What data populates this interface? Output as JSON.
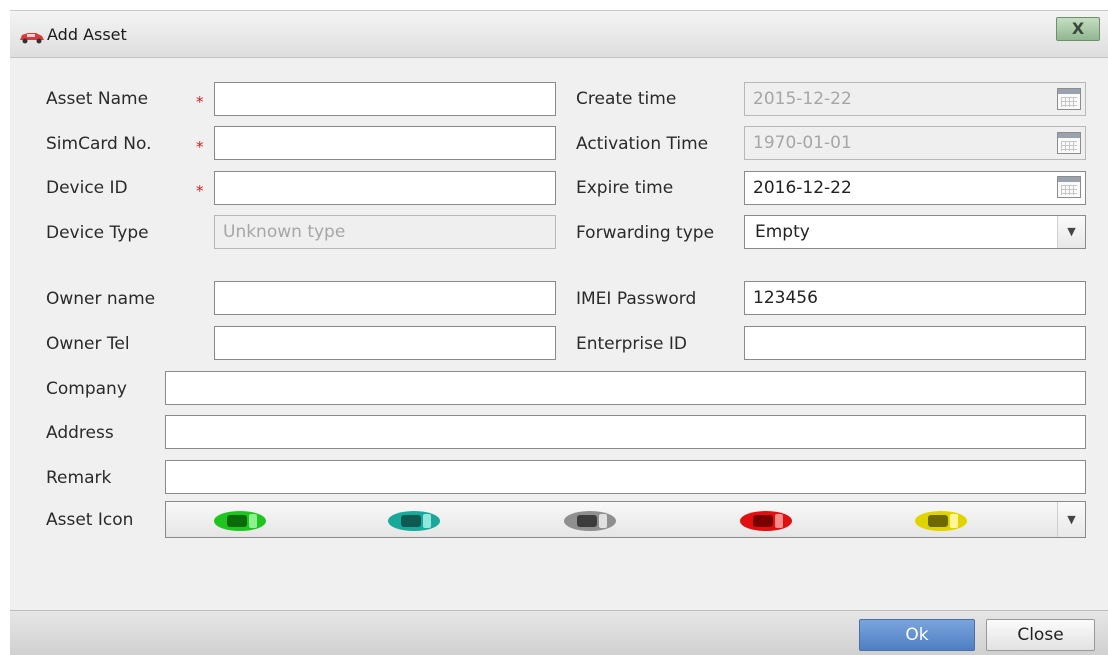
{
  "dialog": {
    "title": "Add Asset",
    "close_symbol": "X"
  },
  "form": {
    "asset_name": {
      "label": "Asset Name",
      "value": ""
    },
    "simcard_no": {
      "label": "SimCard No.",
      "value": ""
    },
    "device_id": {
      "label": "Device ID",
      "value": ""
    },
    "device_type": {
      "label": "Device Type",
      "value": "Unknown type"
    },
    "owner_name": {
      "label": "Owner name",
      "value": ""
    },
    "owner_tel": {
      "label": "Owner Tel",
      "value": ""
    },
    "company": {
      "label": "Company",
      "value": ""
    },
    "address": {
      "label": "Address",
      "value": ""
    },
    "remark": {
      "label": "Remark",
      "value": ""
    },
    "asset_icon": {
      "label": "Asset Icon",
      "options": [
        "green-car",
        "teal-car",
        "gray-car",
        "red-car",
        "yellow-car"
      ]
    },
    "create_time": {
      "label": "Create time",
      "value": "2015-12-22"
    },
    "activation_time": {
      "label": "Activation Time",
      "value": "1970-01-01"
    },
    "expire_time": {
      "label": "Expire time",
      "value": "2016-12-22"
    },
    "forwarding_type": {
      "label": "Forwarding type",
      "value": "Empty"
    },
    "imei_password": {
      "label": "IMEI Password",
      "value": "123456"
    },
    "enterprise_id": {
      "label": "Enterprise ID",
      "value": ""
    },
    "required_marker": "*"
  },
  "colors": {
    "green-car": "#1fc41f",
    "teal-car": "#1aa89a",
    "gray-car": "#8f8f8f",
    "red-car": "#e01010",
    "yellow-car": "#e0d400",
    "ok_button": "#5b88cc",
    "required": "#d02020"
  },
  "footer": {
    "ok_label": "Ok",
    "close_label": "Close"
  }
}
